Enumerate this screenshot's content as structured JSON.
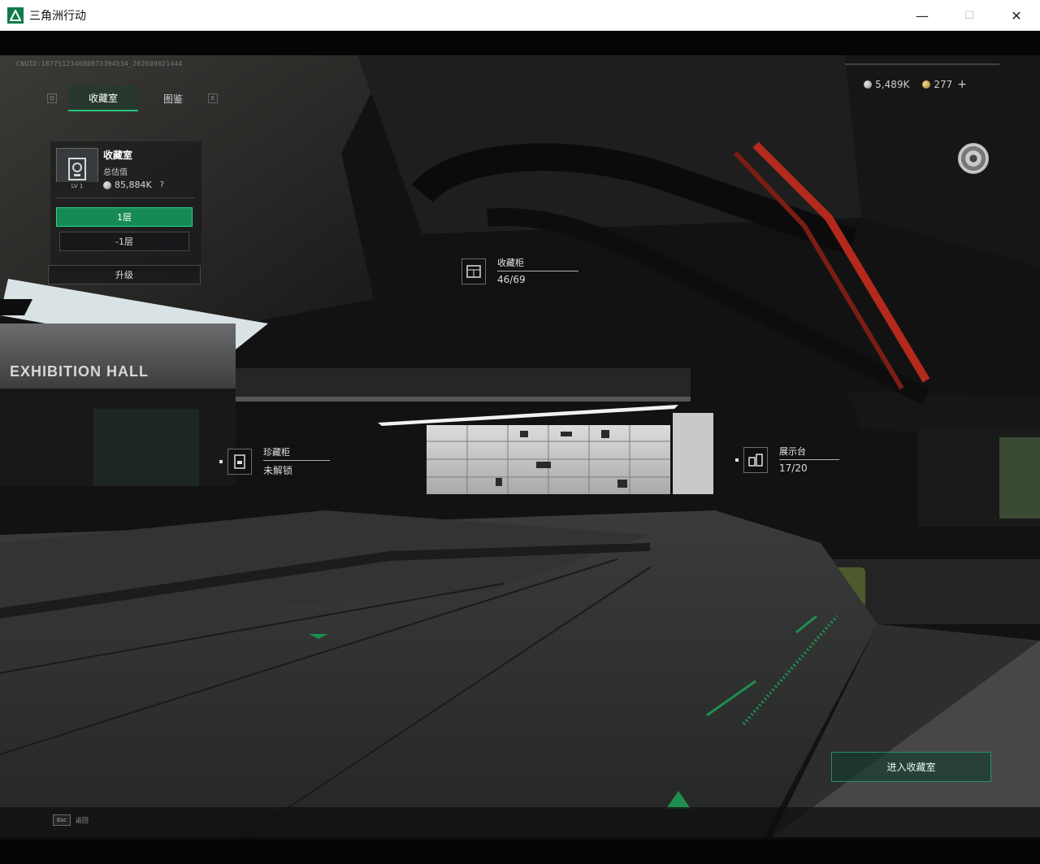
{
  "window": {
    "title": "三角洲行动",
    "controls": {
      "minimize": "—",
      "maximize": "☐",
      "close": "✕"
    }
  },
  "hud": {
    "uid": "CNUID:187751234680873394534_202609021444",
    "tabs": [
      {
        "key": "Q",
        "label": "收藏室",
        "active": true
      },
      {
        "key": "",
        "label": "图鉴",
        "active": false
      },
      {
        "key": "E",
        "label": "",
        "active": false
      }
    ],
    "info": {
      "name": "收藏室",
      "value_label": "总估值",
      "value": "85,884K",
      "level": "LV 1",
      "help": "?"
    },
    "floors": {
      "active": "1层",
      "other": "-1层"
    },
    "upgrade_label": "升级",
    "currency": {
      "silver": "5,489K",
      "gold": "277",
      "plus": "+"
    },
    "floating_labels": {
      "collection_cabinet": {
        "title": "收藏柜",
        "sub": "46/69"
      },
      "treasure_cabinet": {
        "title": "珍藏柜",
        "sub": "未解锁"
      },
      "display_stand": {
        "title": "展示台",
        "sub": "17/20"
      }
    },
    "enter_label": "进入收藏室",
    "esc": {
      "key": "Esc",
      "label": "返回"
    }
  },
  "scene_text": {
    "hall_sign": "EXHIBITION HALL"
  },
  "colors": {
    "accent": "#27c47b",
    "accent_dark": "#168a54",
    "pipe_red": "#b32a1c"
  }
}
